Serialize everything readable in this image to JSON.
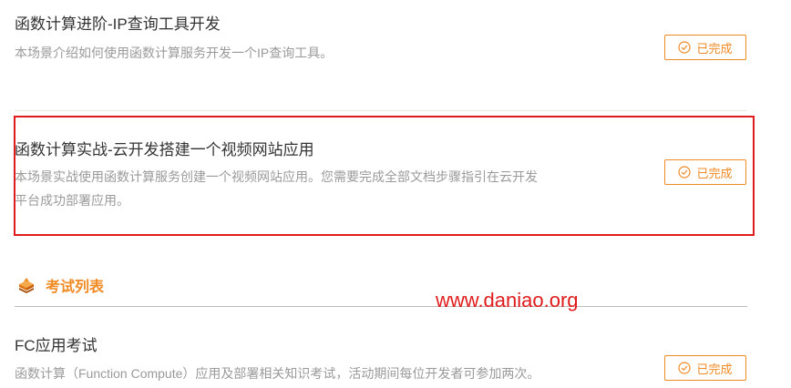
{
  "items": [
    {
      "title": "函数计算进阶-IP查询工具开发",
      "desc": "本场景介绍如何使用函数计算服务开发一个IP查询工具。",
      "status": "已完成"
    },
    {
      "title": "函数计算实战-云开发搭建一个视频网站应用",
      "desc_line1": "本场景实战使用函数计算服务创建一个视频网站应用。您需要完成全部文档步骤指引在云开发",
      "desc_line2": "平台成功部署应用。",
      "status": "已完成"
    }
  ],
  "exam_section": {
    "title": "考试列表",
    "icon": "exam-stack-icon"
  },
  "exams": [
    {
      "title": "FC应用考试",
      "desc": "函数计算（Function Compute）应用及部署相关知识考试，活动期间每位开发者可参加两次。",
      "status": "已完成"
    }
  ],
  "watermark": "www.daniao.org",
  "colors": {
    "accent": "#f08a24",
    "highlight": "#e01b1b",
    "muted_text": "#9a9a9a"
  }
}
